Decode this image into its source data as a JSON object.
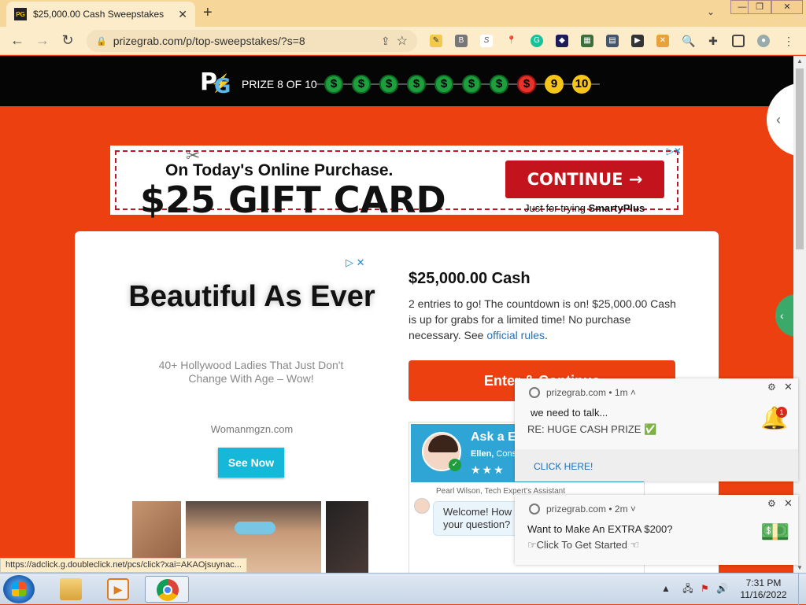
{
  "browser": {
    "tab_title": "$25,000.00 Cash Sweepstakes",
    "tab_favicon": "PG",
    "url": "prizegrab.com/p/top-sweepstakes/?s=8",
    "window_minimize": "—",
    "window_restore": "❐",
    "window_close": "✕",
    "extensions": [
      "ext-icon-1",
      "ext-icon-b",
      "ext-icon-s",
      "map-pin-icon",
      "grammarly-icon",
      "ext-icon-dark",
      "ext-icon-photo",
      "ext-icon-photo2",
      "ext-icon-video",
      "ext-icon-x",
      "magnifier-icon",
      "puzzle-icon",
      "sidepanel-icon",
      "profile-icon",
      "menu-icon"
    ]
  },
  "progress": {
    "label": "PRIZE 8 OF 10",
    "completed_symbol": "$",
    "current_symbol": "$",
    "remaining": [
      "9",
      "10"
    ],
    "completed_count": 7
  },
  "banner_ad": {
    "top_line": "On Today's Online Purchase.",
    "headline": "$25 GIFT CARD",
    "button": "CONTINUE →",
    "sub_prefix": "Just for trying",
    "sub_brand": "SmartyPlus",
    "adchoice": "▷✕"
  },
  "side_ad": {
    "adchoice": "▷ ✕",
    "headline": "Beautiful As Ever",
    "description": "40+ Hollywood Ladies That Just Don't Change With Age – Wow!",
    "source": "Womanmgzn.com",
    "button": "See Now"
  },
  "prize": {
    "title": "$25,000.00 Cash",
    "desc_main": "2 entries to go! The countdown is on! $25,000.00 Cash is up for grabs for a limited time! No purchase necessary. See ",
    "rules_link": "official rules",
    "desc_end": ".",
    "enter_button": "Enter & Continue"
  },
  "chat": {
    "title": "Ask a Expert",
    "subtitle_name": "Ellen,",
    "subtitle_role": "Cons",
    "stars": "★★★",
    "meta": "Pearl Wilson, Tech Expert's Assistant",
    "bubble": "Welcome! How can I help with your question?"
  },
  "notifications": [
    {
      "site": "prizegrab.com",
      "time": "• 1m ˄",
      "title": "we need to talk...",
      "body": "RE: HUGE CASH PRIZE ✅",
      "badge": "1",
      "action": "CLICK HERE!"
    },
    {
      "site": "prizegrab.com",
      "time": "• 2m ˅",
      "title": "Want to Make An EXTRA $200?",
      "body": "☞Click To Get Started ☜"
    }
  ],
  "status_url": "https://adclick.g.doubleclick.net/pcs/click?xai=AKAOjsuynac...",
  "taskbar": {
    "time": "7:31 PM",
    "date": "11/16/2022"
  },
  "colors": {
    "page_bg": "#ed4010",
    "done_dot": "#1e9e3c",
    "current_dot": "#e6322a",
    "todo_dot": "#f5c518",
    "banner_button": "#c3141d"
  }
}
